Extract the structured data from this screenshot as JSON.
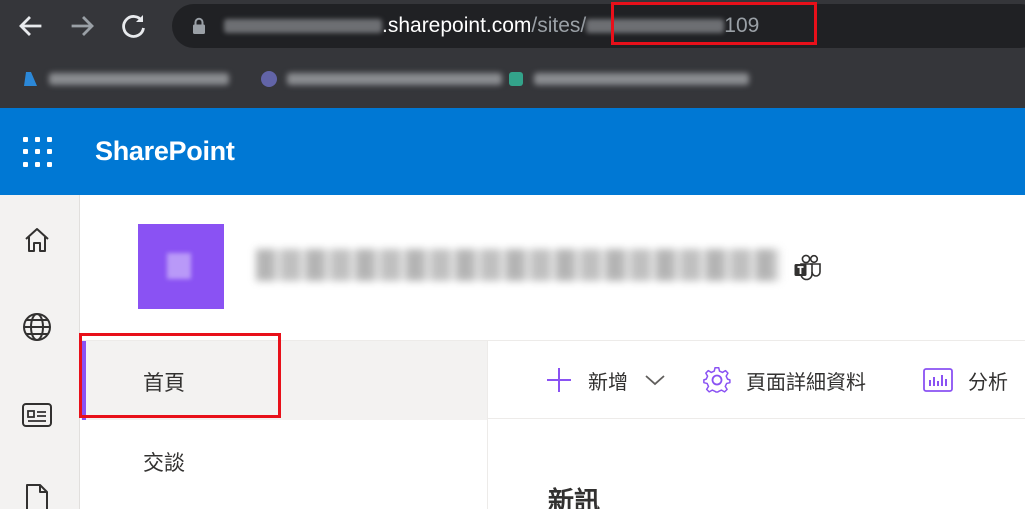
{
  "browser": {
    "url_visible_host": ".sharepoint.com",
    "url_visible_path": "/sites/",
    "url_visible_suffix": "109"
  },
  "suite": {
    "brand": "SharePoint",
    "accent_color": "#0078d4",
    "brand_icon": "waffle-icon"
  },
  "appbar": {
    "items": [
      {
        "icon": "home-icon"
      },
      {
        "icon": "globe-icon"
      },
      {
        "icon": "news-icon"
      },
      {
        "icon": "file-icon"
      }
    ]
  },
  "site": {
    "logo_color": "#8a52f3",
    "teams_icon": "teams-icon"
  },
  "leftnav": {
    "items": [
      {
        "label": "首頁",
        "selected": true
      },
      {
        "label": "交談",
        "selected": false
      }
    ]
  },
  "commandbar": {
    "new_label": "新增",
    "page_details_label": "頁面詳細資料",
    "analytics_label": "分析"
  },
  "content": {
    "news_heading": "新訊"
  },
  "annotations": {
    "highlight_color": "#e8101a"
  }
}
